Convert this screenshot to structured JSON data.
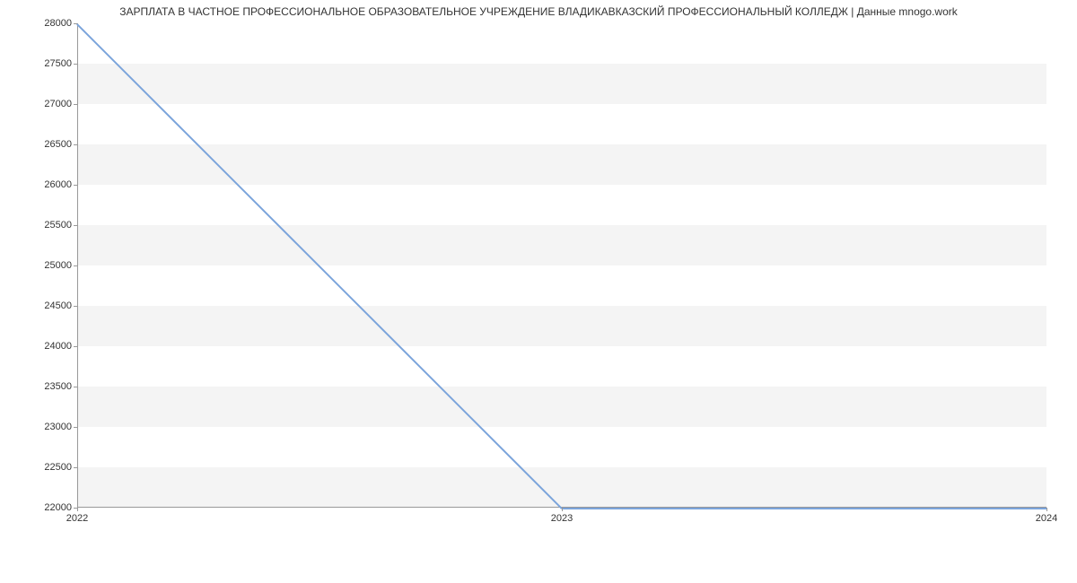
{
  "chart_data": {
    "type": "line",
    "title": "ЗАРПЛАТА В ЧАСТНОЕ ПРОФЕССИОНАЛЬНОЕ ОБРАЗОВАТЕЛЬНОЕ УЧРЕЖДЕНИЕ ВЛАДИКАВКАЗСКИЙ ПРОФЕССИОНАЛЬНЫЙ КОЛЛЕДЖ | Данные mnogo.work",
    "x": [
      "2022",
      "2023",
      "2024"
    ],
    "values": [
      28000,
      22000,
      22000
    ],
    "xlabel": "",
    "ylabel": "",
    "ylim": [
      22000,
      28000
    ],
    "y_ticks": [
      22000,
      22500,
      23000,
      23500,
      24000,
      24500,
      25000,
      25500,
      26000,
      26500,
      27000,
      27500,
      28000
    ],
    "x_ticks": [
      "2022",
      "2023",
      "2024"
    ],
    "grid": true,
    "line_color": "#7ba4db"
  }
}
